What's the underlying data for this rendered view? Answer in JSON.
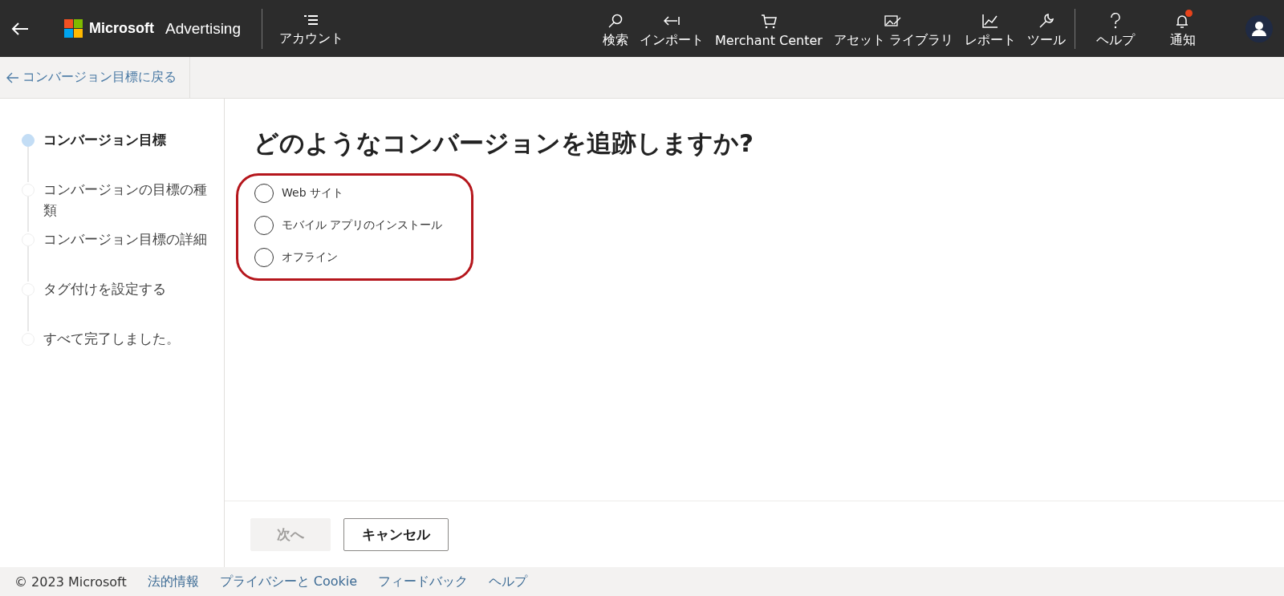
{
  "header": {
    "brand": "Microsoft",
    "product": "Advertising",
    "account": "アカウント",
    "nav": [
      {
        "kind": "search",
        "label": "検索",
        "badge": false
      },
      {
        "kind": "import",
        "label": "インポート",
        "badge": false
      },
      {
        "kind": "cart",
        "label": "Merchant Center",
        "badge": false
      },
      {
        "kind": "assets",
        "label": "アセット ライブラリ",
        "badge": false
      },
      {
        "kind": "chart",
        "label": "レポート",
        "badge": false
      },
      {
        "kind": "wrench",
        "label": "ツール",
        "badge": false
      }
    ],
    "utility_nav": [
      {
        "kind": "help",
        "label": "ヘルプ",
        "badge": false
      },
      {
        "kind": "bell",
        "label": "通知",
        "badge": true
      }
    ]
  },
  "back_link": "コンバージョン目標に戻る",
  "steps": [
    {
      "label": "コンバージョン目標",
      "selected": true
    },
    {
      "label": "コンバージョンの目標の種類",
      "selected": false
    },
    {
      "label": "コンバージョン目標の詳細",
      "selected": false
    },
    {
      "label": "タグ付けを設定する",
      "selected": false
    },
    {
      "label": "すべて完了しました。",
      "selected": false
    }
  ],
  "question": "どのようなコンバージョンを追跡しますか?",
  "options_highlighted": true,
  "options": [
    {
      "label": "Web サイト",
      "selected": false
    },
    {
      "label": "モバイル アプリのインストール",
      "selected": false
    },
    {
      "label": "オフライン",
      "selected": false
    }
  ],
  "buttons": [
    {
      "label": "次へ",
      "disabled": true
    },
    {
      "label": "キャンセル",
      "disabled": false
    }
  ],
  "footer": {
    "copyright": "© 2023 Microsoft",
    "links": [
      "法的情報",
      "プライバシーと Cookie",
      "フィードバック",
      "ヘルプ"
    ]
  }
}
